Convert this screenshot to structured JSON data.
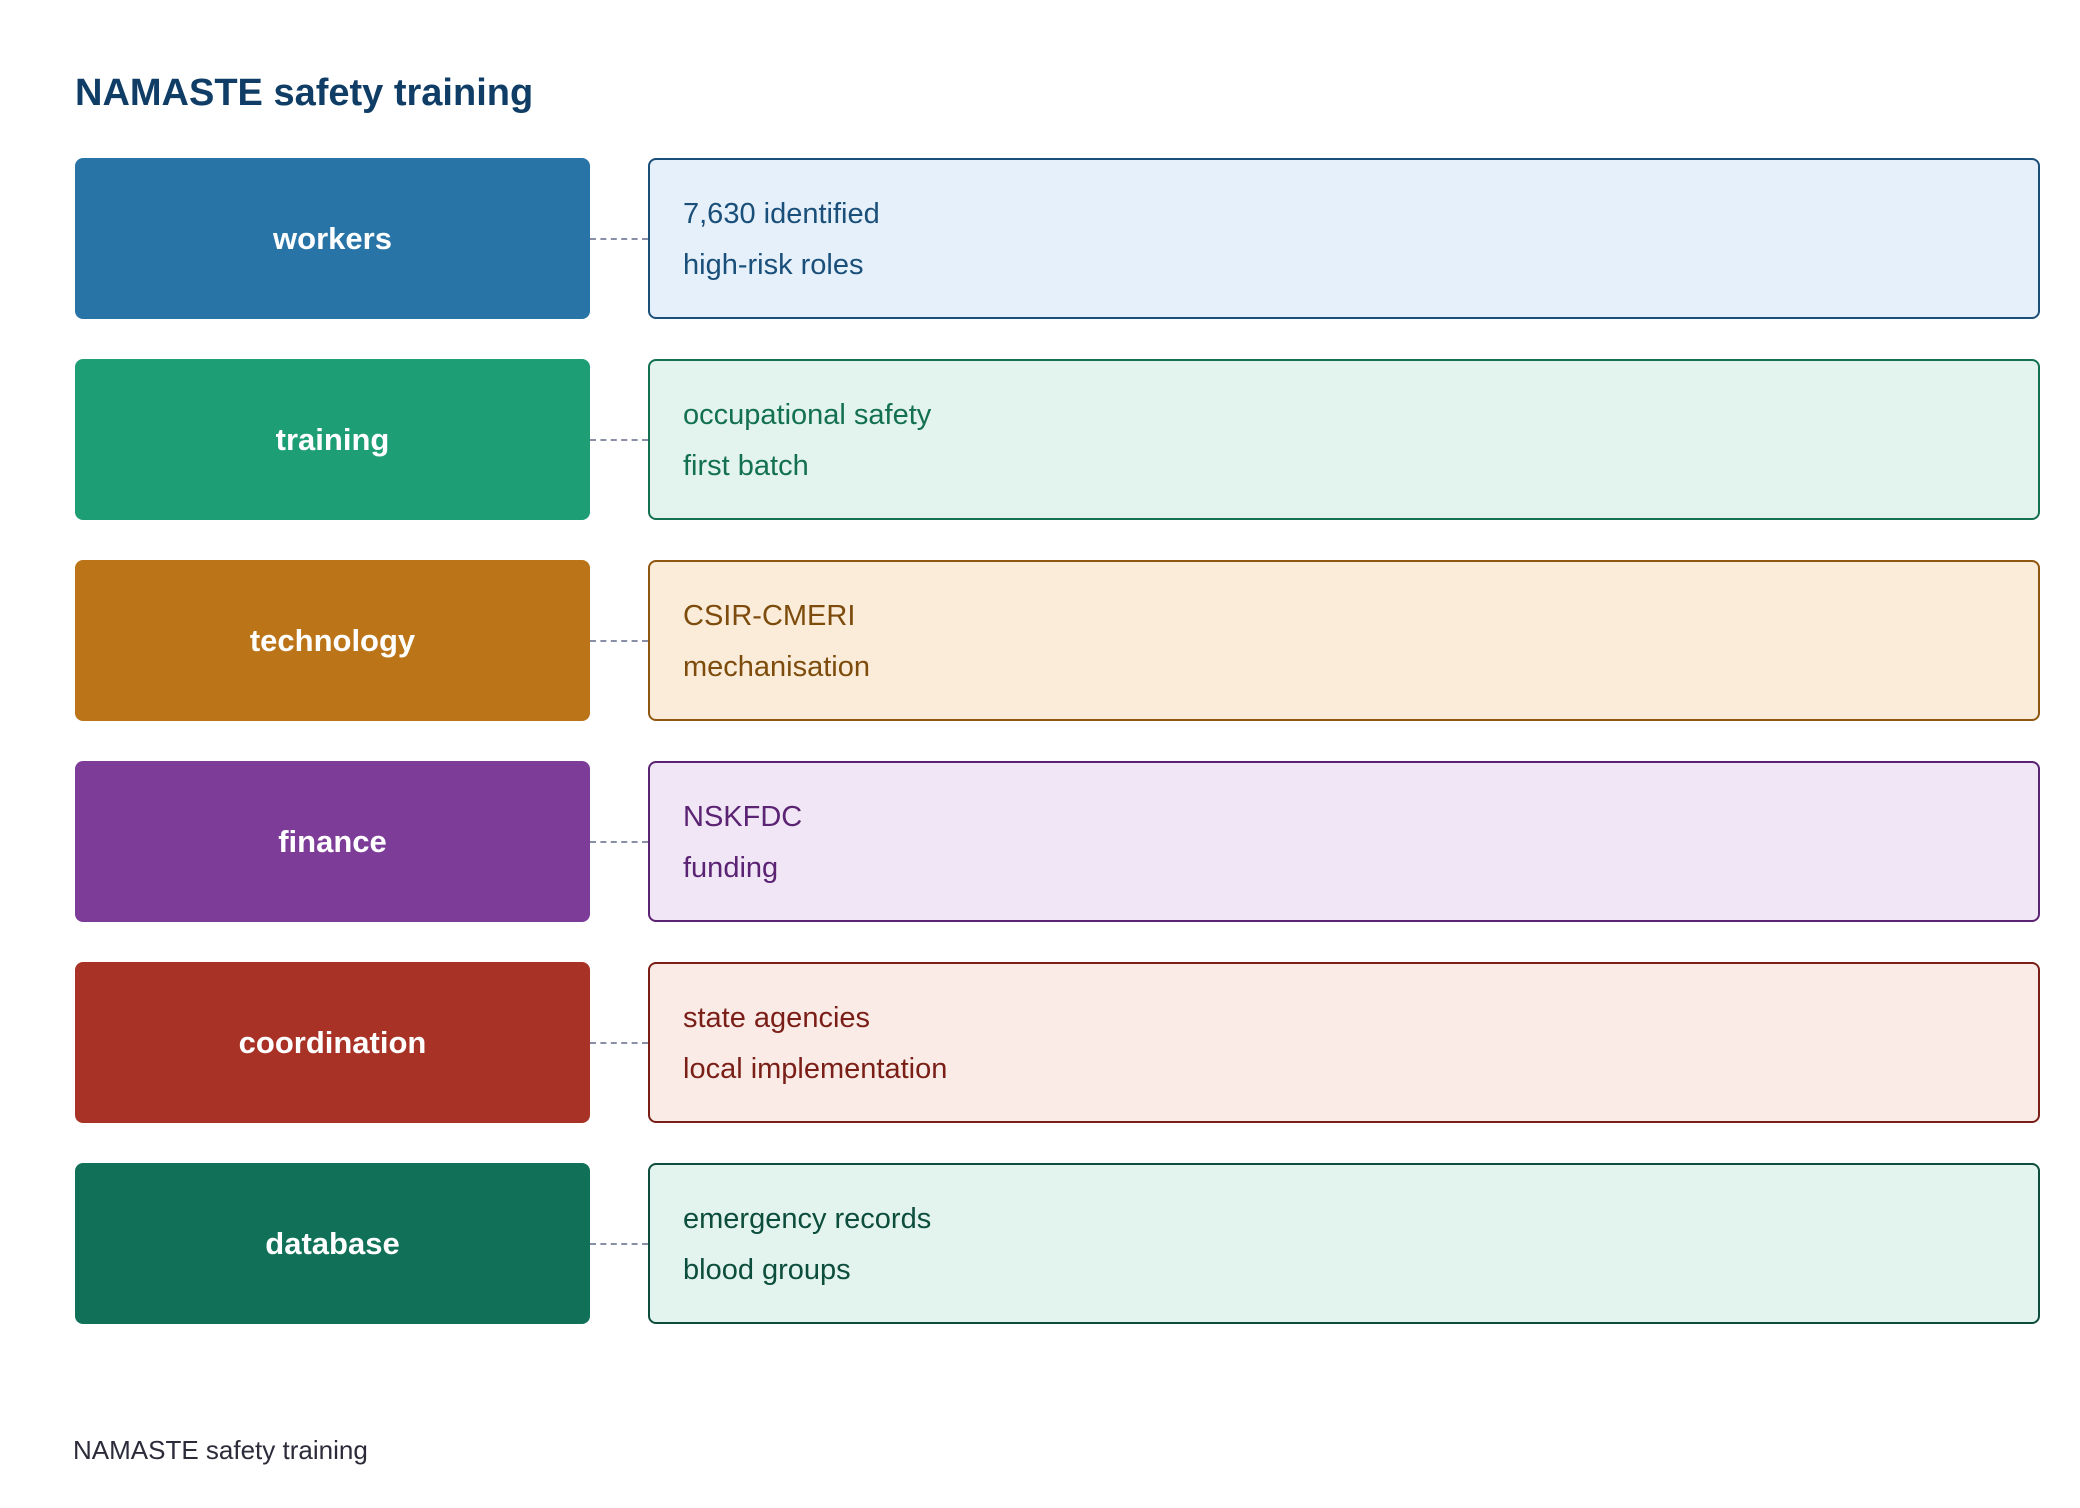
{
  "title": "NAMASTE safety training",
  "footer": "NAMASTE safety training",
  "rows": [
    {
      "category": "workers",
      "lines": [
        "7,630 identified",
        "high-risk roles"
      ],
      "colors": {
        "box": "#2874a6",
        "fill": "#e5f0fa",
        "border": "#1a4f7a",
        "text": "#1a4f7a"
      }
    },
    {
      "category": "training",
      "lines": [
        "occupational safety",
        "first batch"
      ],
      "colors": {
        "box": "#1e9e74",
        "fill": "#e2f4ed",
        "border": "#137050",
        "text": "#137050"
      }
    },
    {
      "category": "technology",
      "lines": [
        "CSIR-CMERI",
        "mechanisation"
      ],
      "colors": {
        "box": "#bb7518",
        "fill": "#fbecd9",
        "border": "#8f560f",
        "text": "#7d4c0d"
      }
    },
    {
      "category": "finance",
      "lines": [
        "NSKFDC",
        "funding"
      ],
      "colors": {
        "box": "#7d3c98",
        "fill": "#f0e6f5",
        "border": "#5b2373",
        "text": "#5b2373"
      }
    },
    {
      "category": "coordination",
      "lines": [
        "state agencies",
        "local implementation"
      ],
      "colors": {
        "box": "#a93226",
        "fill": "#faebe6",
        "border": "#7a1f17",
        "text": "#7a1f17"
      }
    },
    {
      "category": "database",
      "lines": [
        "emergency records",
        "blood groups"
      ],
      "colors": {
        "box": "#117058",
        "fill": "#e2f4ed",
        "border": "#0c4d3c",
        "text": "#0c4d3c"
      }
    }
  ]
}
